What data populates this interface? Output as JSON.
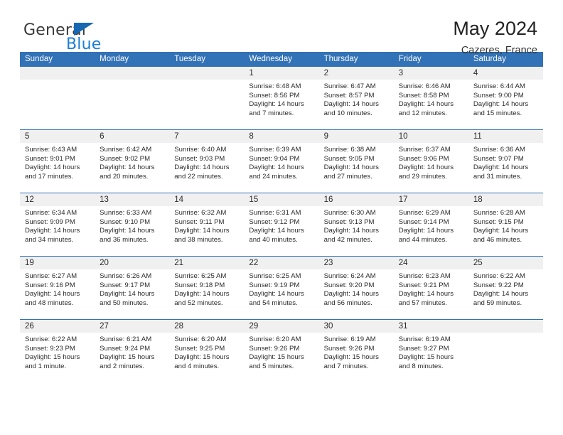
{
  "brand": {
    "name_top": "General",
    "name_bottom": "Blue",
    "triangle_icon": "brand-triangle-icon",
    "color_dark": "#3a3a3a",
    "color_blue": "#1a7fd4"
  },
  "header": {
    "title": "May 2024",
    "subtitle": "Cazeres, France"
  },
  "theme": {
    "header_bg": "#3272b6",
    "header_text": "#ffffff",
    "daynum_band_bg": "#f0f0f0",
    "week_divider": "#3272b6",
    "body_text": "#2b2b2b"
  },
  "weekdays": [
    "Sunday",
    "Monday",
    "Tuesday",
    "Wednesday",
    "Thursday",
    "Friday",
    "Saturday"
  ],
  "weeks": [
    [
      {
        "day": "",
        "lines": []
      },
      {
        "day": "",
        "lines": []
      },
      {
        "day": "",
        "lines": []
      },
      {
        "day": "1",
        "lines": [
          "Sunrise: 6:48 AM",
          "Sunset: 8:56 PM",
          "Daylight: 14 hours",
          "and 7 minutes."
        ]
      },
      {
        "day": "2",
        "lines": [
          "Sunrise: 6:47 AM",
          "Sunset: 8:57 PM",
          "Daylight: 14 hours",
          "and 10 minutes."
        ]
      },
      {
        "day": "3",
        "lines": [
          "Sunrise: 6:46 AM",
          "Sunset: 8:58 PM",
          "Daylight: 14 hours",
          "and 12 minutes."
        ]
      },
      {
        "day": "4",
        "lines": [
          "Sunrise: 6:44 AM",
          "Sunset: 9:00 PM",
          "Daylight: 14 hours",
          "and 15 minutes."
        ]
      }
    ],
    [
      {
        "day": "5",
        "lines": [
          "Sunrise: 6:43 AM",
          "Sunset: 9:01 PM",
          "Daylight: 14 hours",
          "and 17 minutes."
        ]
      },
      {
        "day": "6",
        "lines": [
          "Sunrise: 6:42 AM",
          "Sunset: 9:02 PM",
          "Daylight: 14 hours",
          "and 20 minutes."
        ]
      },
      {
        "day": "7",
        "lines": [
          "Sunrise: 6:40 AM",
          "Sunset: 9:03 PM",
          "Daylight: 14 hours",
          "and 22 minutes."
        ]
      },
      {
        "day": "8",
        "lines": [
          "Sunrise: 6:39 AM",
          "Sunset: 9:04 PM",
          "Daylight: 14 hours",
          "and 24 minutes."
        ]
      },
      {
        "day": "9",
        "lines": [
          "Sunrise: 6:38 AM",
          "Sunset: 9:05 PM",
          "Daylight: 14 hours",
          "and 27 minutes."
        ]
      },
      {
        "day": "10",
        "lines": [
          "Sunrise: 6:37 AM",
          "Sunset: 9:06 PM",
          "Daylight: 14 hours",
          "and 29 minutes."
        ]
      },
      {
        "day": "11",
        "lines": [
          "Sunrise: 6:36 AM",
          "Sunset: 9:07 PM",
          "Daylight: 14 hours",
          "and 31 minutes."
        ]
      }
    ],
    [
      {
        "day": "12",
        "lines": [
          "Sunrise: 6:34 AM",
          "Sunset: 9:09 PM",
          "Daylight: 14 hours",
          "and 34 minutes."
        ]
      },
      {
        "day": "13",
        "lines": [
          "Sunrise: 6:33 AM",
          "Sunset: 9:10 PM",
          "Daylight: 14 hours",
          "and 36 minutes."
        ]
      },
      {
        "day": "14",
        "lines": [
          "Sunrise: 6:32 AM",
          "Sunset: 9:11 PM",
          "Daylight: 14 hours",
          "and 38 minutes."
        ]
      },
      {
        "day": "15",
        "lines": [
          "Sunrise: 6:31 AM",
          "Sunset: 9:12 PM",
          "Daylight: 14 hours",
          "and 40 minutes."
        ]
      },
      {
        "day": "16",
        "lines": [
          "Sunrise: 6:30 AM",
          "Sunset: 9:13 PM",
          "Daylight: 14 hours",
          "and 42 minutes."
        ]
      },
      {
        "day": "17",
        "lines": [
          "Sunrise: 6:29 AM",
          "Sunset: 9:14 PM",
          "Daylight: 14 hours",
          "and 44 minutes."
        ]
      },
      {
        "day": "18",
        "lines": [
          "Sunrise: 6:28 AM",
          "Sunset: 9:15 PM",
          "Daylight: 14 hours",
          "and 46 minutes."
        ]
      }
    ],
    [
      {
        "day": "19",
        "lines": [
          "Sunrise: 6:27 AM",
          "Sunset: 9:16 PM",
          "Daylight: 14 hours",
          "and 48 minutes."
        ]
      },
      {
        "day": "20",
        "lines": [
          "Sunrise: 6:26 AM",
          "Sunset: 9:17 PM",
          "Daylight: 14 hours",
          "and 50 minutes."
        ]
      },
      {
        "day": "21",
        "lines": [
          "Sunrise: 6:25 AM",
          "Sunset: 9:18 PM",
          "Daylight: 14 hours",
          "and 52 minutes."
        ]
      },
      {
        "day": "22",
        "lines": [
          "Sunrise: 6:25 AM",
          "Sunset: 9:19 PM",
          "Daylight: 14 hours",
          "and 54 minutes."
        ]
      },
      {
        "day": "23",
        "lines": [
          "Sunrise: 6:24 AM",
          "Sunset: 9:20 PM",
          "Daylight: 14 hours",
          "and 56 minutes."
        ]
      },
      {
        "day": "24",
        "lines": [
          "Sunrise: 6:23 AM",
          "Sunset: 9:21 PM",
          "Daylight: 14 hours",
          "and 57 minutes."
        ]
      },
      {
        "day": "25",
        "lines": [
          "Sunrise: 6:22 AM",
          "Sunset: 9:22 PM",
          "Daylight: 14 hours",
          "and 59 minutes."
        ]
      }
    ],
    [
      {
        "day": "26",
        "lines": [
          "Sunrise: 6:22 AM",
          "Sunset: 9:23 PM",
          "Daylight: 15 hours",
          "and 1 minute."
        ]
      },
      {
        "day": "27",
        "lines": [
          "Sunrise: 6:21 AM",
          "Sunset: 9:24 PM",
          "Daylight: 15 hours",
          "and 2 minutes."
        ]
      },
      {
        "day": "28",
        "lines": [
          "Sunrise: 6:20 AM",
          "Sunset: 9:25 PM",
          "Daylight: 15 hours",
          "and 4 minutes."
        ]
      },
      {
        "day": "29",
        "lines": [
          "Sunrise: 6:20 AM",
          "Sunset: 9:26 PM",
          "Daylight: 15 hours",
          "and 5 minutes."
        ]
      },
      {
        "day": "30",
        "lines": [
          "Sunrise: 6:19 AM",
          "Sunset: 9:26 PM",
          "Daylight: 15 hours",
          "and 7 minutes."
        ]
      },
      {
        "day": "31",
        "lines": [
          "Sunrise: 6:19 AM",
          "Sunset: 9:27 PM",
          "Daylight: 15 hours",
          "and 8 minutes."
        ]
      },
      {
        "day": "",
        "lines": []
      }
    ]
  ]
}
